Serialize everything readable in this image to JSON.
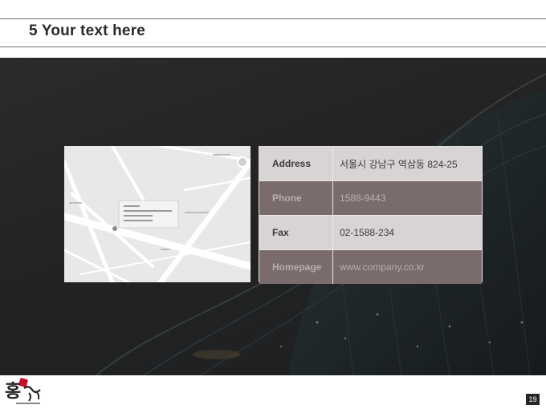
{
  "header": {
    "title": "5 Your text here"
  },
  "contact": {
    "rows": [
      {
        "label": "Address",
        "value": "서울시 강남구 역삼동 824-25",
        "style": "light"
      },
      {
        "label": "Phone",
        "value": "1588-9443",
        "style": "dark"
      },
      {
        "label": "Fax",
        "value": "02-1588-234",
        "style": "light"
      },
      {
        "label": "Homepage",
        "value": "www.company.co.kr",
        "style": "dark"
      }
    ]
  },
  "logo": {
    "text": "홍"
  },
  "footer": {
    "page_number": "19"
  },
  "colors": {
    "row_light": "#d9d4d4",
    "row_dark": "#7a6b6c",
    "hero_bg": "#232323",
    "logo_accent": "#c8102e"
  }
}
